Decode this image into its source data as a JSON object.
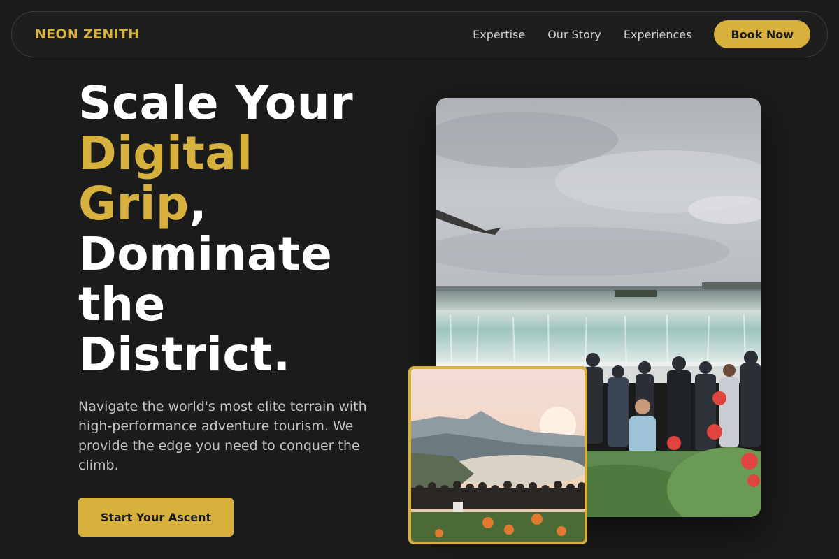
{
  "brand": {
    "name": "NEON ZENITH"
  },
  "nav": {
    "links": [
      "Expertise",
      "Our Story",
      "Experiences"
    ],
    "book_label": "Book Now"
  },
  "hero": {
    "line1": "Scale Your",
    "line2": "Digital",
    "line3_accent": "Grip",
    "line3_rest": ",",
    "line4": "Dominate",
    "line5": "the",
    "line6": "District.",
    "description": "Navigate the world's most elite terrain with high-performance adventure tourism. We provide the edge you need to conquer the climb.",
    "cta_label": "Start Your Ascent"
  },
  "images": {
    "main": "waterfall-crowd-photo",
    "secondary": "bay-sunset-crowd-photo"
  },
  "colors": {
    "background": "#1b1b1b",
    "accent": "#d8b13c",
    "text": "#ffffff",
    "muted": "#c4c4c4"
  }
}
